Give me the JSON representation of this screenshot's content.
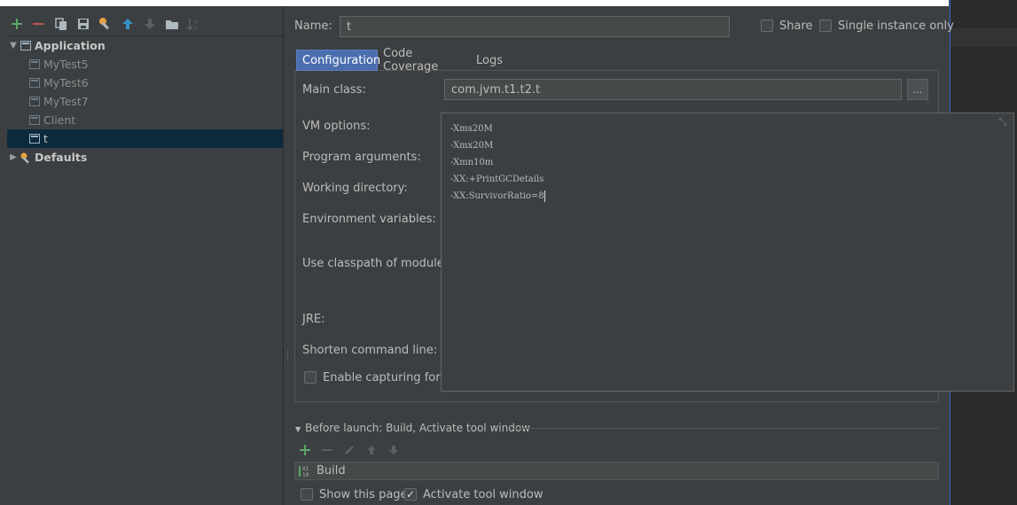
{
  "left_toolbar": {
    "icons": [
      "add-icon",
      "remove-icon",
      "copy-icon",
      "save-icon",
      "wrench-icon",
      "move-up-icon",
      "move-down-icon",
      "folder-icon",
      "sort-icon"
    ]
  },
  "tree": {
    "application": "Application",
    "items": [
      "MyTest5",
      "MyTest6",
      "MyTest7",
      "Client",
      "t"
    ],
    "defaults": "Defaults"
  },
  "header": {
    "name_label": "Name:",
    "name_value": "t",
    "share_label": "Share",
    "single_instance_label": "Single instance only"
  },
  "tabs": [
    "Configuration",
    "Code Coverage",
    "Logs"
  ],
  "form": {
    "main_class_label": "Main class:",
    "main_class_value": "com.jvm.t1.t2.t",
    "browse_label": "...",
    "vm_options_label": "VM options:",
    "program_arguments_label": "Program arguments:",
    "working_directory_label": "Working directory:",
    "environment_variables_label": "Environment variables:",
    "use_classpath_label": "Use classpath of module:",
    "jre_label": "JRE:",
    "shorten_command_line_label": "Shorten command line:",
    "enable_capturing_label": "Enable capturing form"
  },
  "vm_options_lines": [
    "-Xms20M",
    "-Xmx20M",
    "-Xmn10m",
    "-XX:+PrintGCDetails",
    "-XX:SurvivorRatio=8"
  ],
  "before_launch": {
    "title": "Before launch: Build, Activate tool window",
    "task": "Build",
    "show_this_page": "Show this page",
    "activate_tool_window": "Activate tool window"
  }
}
